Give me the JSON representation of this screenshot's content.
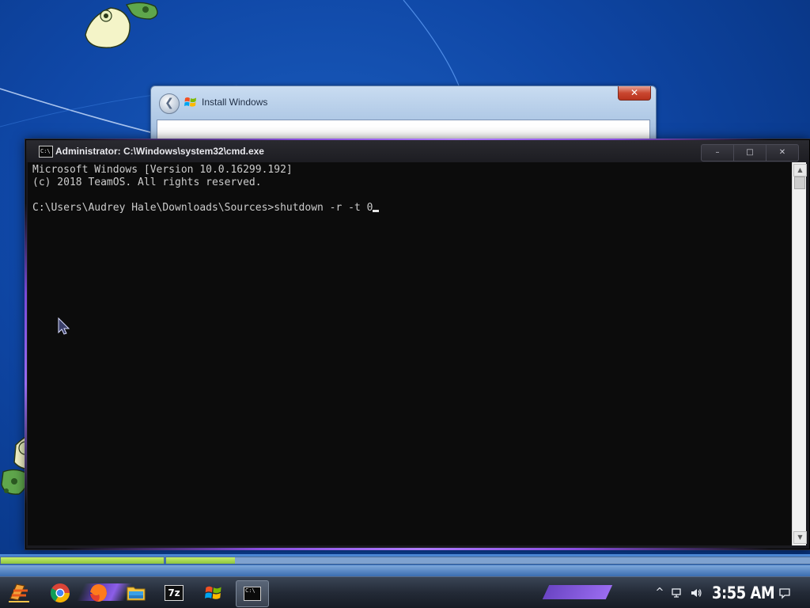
{
  "desktop": {
    "background_color": "#0f47a6"
  },
  "install_dialog": {
    "title": "Install Windows",
    "close_label": "✕",
    "back_label": "❮",
    "flag_icon": "windows-flag-icon"
  },
  "cmd": {
    "title": "Administrator: C:\\Windows\\system32\\cmd.exe",
    "minimize_label": "–",
    "maximize_label": "□",
    "close_label": "✕",
    "lines": [
      "Microsoft Windows [Version 10.0.16299.192]",
      "(c) 2018 TeamOS. All rights reserved.",
      "",
      "C:\\Users\\Audrey Hale\\Downloads\\Sources>shutdown -r -t 0"
    ],
    "icon_text": "C:\\",
    "text_color": "#cccccc",
    "background_color": "#0c0c0c"
  },
  "progress": {
    "stage1_fraction": 1.0,
    "stage2_fraction": 0.107,
    "fill_color": "#8cc63f"
  },
  "taskbar": {
    "items": [
      {
        "name": "start",
        "icon": "start-icon"
      },
      {
        "name": "chrome",
        "icon": "chrome-icon"
      },
      {
        "name": "firefox",
        "icon": "firefox-icon"
      },
      {
        "name": "file-explorer",
        "icon": "folder-icon"
      },
      {
        "name": "7zip",
        "icon": "7zip-icon",
        "label": "7z"
      },
      {
        "name": "windows-setup",
        "icon": "windows-flag-icon"
      },
      {
        "name": "command-prompt",
        "icon": "cmd-icon",
        "active": true
      }
    ],
    "tray": {
      "show_hidden_label": "^",
      "clock": "3:55 AM",
      "network_icon": "network-icon",
      "volume_icon": "volume-icon",
      "notification_icon": "notification-icon"
    }
  },
  "accent_colors": {
    "purple_glow": "#8a4fe0",
    "install_close": "#c9462f"
  }
}
